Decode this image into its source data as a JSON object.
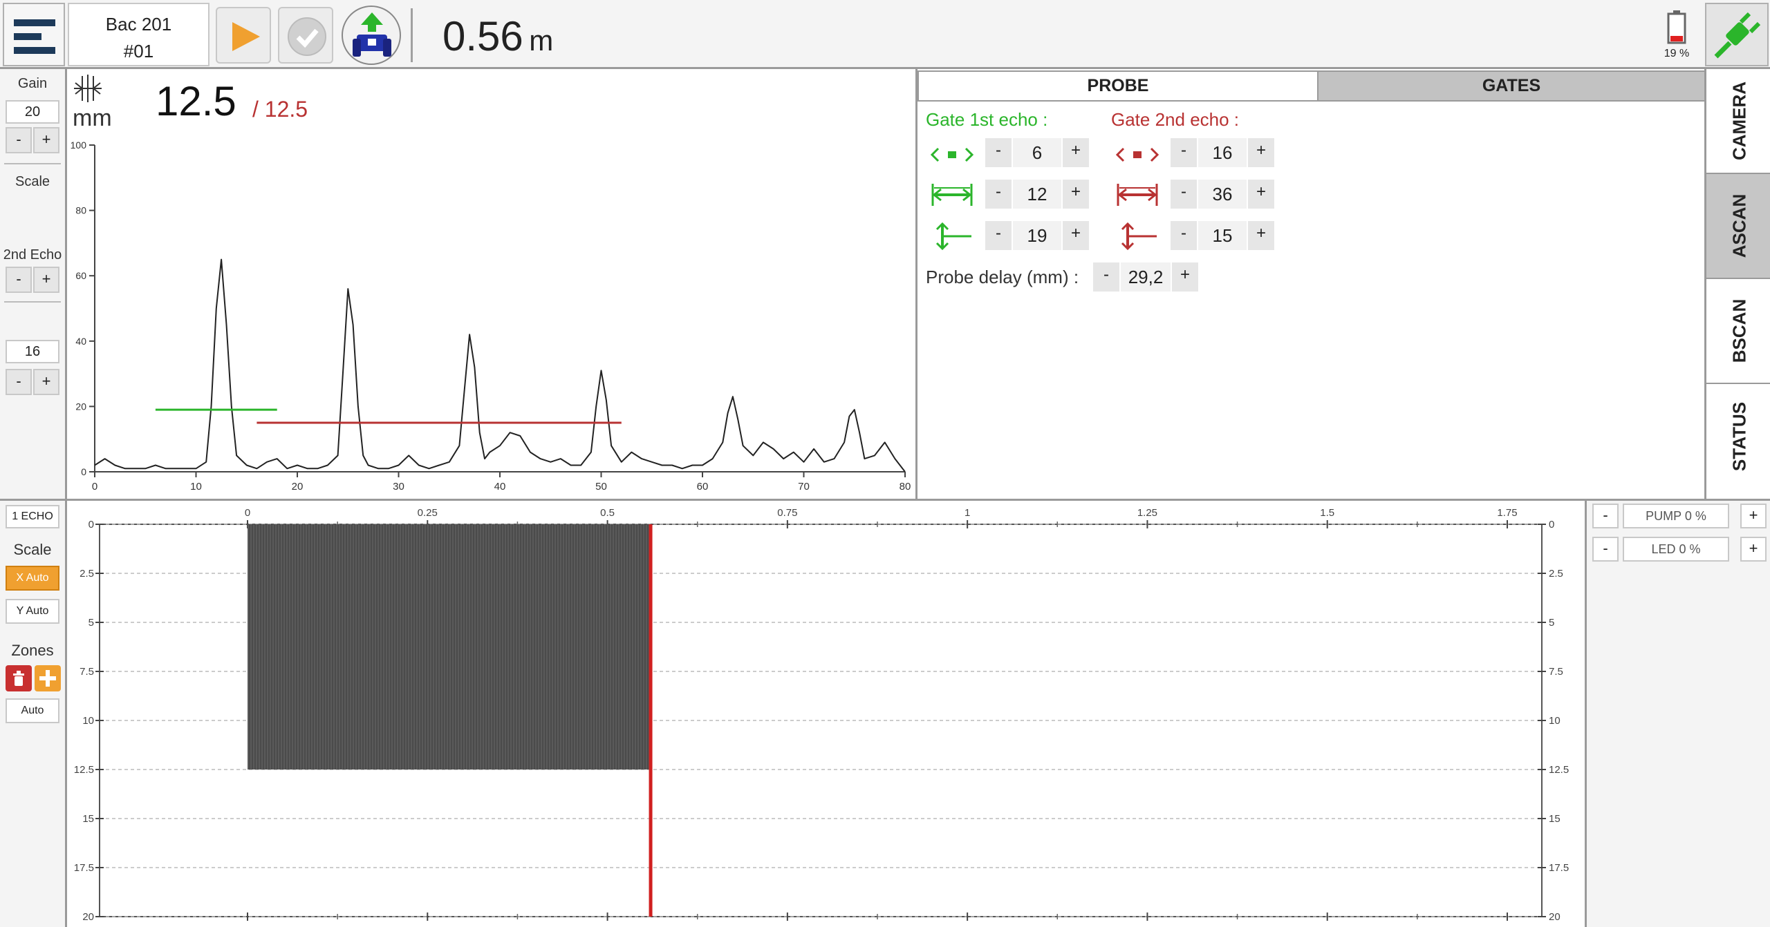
{
  "header": {
    "site": "Bac 201",
    "probe_id": "#01",
    "distance_value": "0.56",
    "distance_unit": "m",
    "battery": "19 %"
  },
  "left_panel": {
    "gain_label": "Gain",
    "gain_value": "20",
    "scale_label": "Scale",
    "second_echo_label": "2nd Echo",
    "second_echo_value": "16",
    "minus": "-",
    "plus": "+"
  },
  "ascan": {
    "unit": "mm",
    "thickness": "12.5",
    "thickness_second": "/ 12.5"
  },
  "tabs": {
    "probe": "PROBE",
    "gates": "GATES"
  },
  "gates": {
    "first_label": "Gate 1st echo :",
    "second_label": "Gate 2nd echo :",
    "first": {
      "position": "6",
      "width": "12",
      "level": "19"
    },
    "second": {
      "position": "16",
      "width": "36",
      "level": "15"
    },
    "probe_delay_label": "Probe delay (mm) :",
    "probe_delay_value": "29,2"
  },
  "side_tabs": [
    "CAMERA",
    "ASCAN",
    "BSCAN",
    "STATUS"
  ],
  "bscan_controls": {
    "echo_mode": "1 ECHO",
    "scale_label": "Scale",
    "x_auto": "X Auto",
    "y_auto": "Y Auto",
    "zones_label": "Zones",
    "auto": "Auto"
  },
  "right_controls": {
    "pump": "PUMP 0 %",
    "led": "LED 0 %"
  },
  "colors": {
    "green": "#2bb52b",
    "red": "#b83232",
    "accent_orange": "#f0a030",
    "bscan_fill": "#5a5a5a",
    "cursor": "#d02020"
  },
  "chart_data": [
    {
      "type": "line",
      "x_ticks": [
        "0",
        "10",
        "20",
        "30",
        "40",
        "50",
        "60",
        "70",
        "80"
      ],
      "y_ticks": [
        "0",
        "20",
        "40",
        "60",
        "80",
        "100"
      ],
      "xlim": [
        0,
        80
      ],
      "ylim": [
        0,
        100
      ],
      "series": [
        {
          "x": [
            0,
            1,
            2,
            3,
            4,
            5,
            6,
            7,
            8,
            9,
            10,
            11,
            11.5,
            12,
            12.5,
            13,
            13.5,
            14,
            15,
            16,
            17,
            18,
            19,
            20,
            21,
            22,
            23,
            24,
            24.5,
            25,
            25.5,
            26,
            26.5,
            27,
            28,
            29,
            30,
            31,
            32,
            33,
            34,
            35,
            36,
            36.5,
            37,
            37.5,
            38,
            38.5,
            39,
            40,
            41,
            42,
            43,
            44,
            45,
            46,
            47,
            48,
            49,
            49.5,
            50,
            50.5,
            51,
            52,
            53,
            54,
            55,
            56,
            57,
            58,
            59,
            60,
            61,
            62,
            62.5,
            63,
            63.5,
            64,
            65,
            66,
            67,
            68,
            69,
            70,
            71,
            72,
            73,
            74,
            74.5,
            75,
            75.5,
            76,
            77,
            78,
            79,
            80
          ],
          "y": [
            2,
            4,
            2,
            1,
            1,
            1,
            2,
            1,
            1,
            1,
            1,
            3,
            20,
            50,
            65,
            45,
            20,
            5,
            2,
            1,
            3,
            4,
            1,
            2,
            1,
            1,
            2,
            5,
            30,
            56,
            45,
            20,
            5,
            2,
            1,
            1,
            2,
            5,
            2,
            1,
            2,
            3,
            8,
            25,
            42,
            32,
            12,
            4,
            6,
            8,
            12,
            11,
            6,
            4,
            3,
            4,
            2,
            2,
            6,
            20,
            31,
            22,
            8,
            3,
            6,
            4,
            3,
            2,
            2,
            1,
            2,
            2,
            4,
            9,
            18,
            23,
            16,
            8,
            5,
            9,
            7,
            4,
            6,
            3,
            7,
            3,
            4,
            9,
            17,
            19,
            12,
            4,
            5,
            9,
            4,
            0
          ]
        }
      ],
      "gates": [
        {
          "name": "Gate 1st echo",
          "x": [
            6,
            18
          ],
          "y": 19
        },
        {
          "name": "Gate 2nd echo",
          "x": [
            16,
            52
          ],
          "y": 15
        }
      ]
    },
    {
      "type": "area",
      "x_ticks": [
        "0",
        "0.25",
        "0.5",
        "0.75",
        "1",
        "1.25",
        "1.5",
        "1.75"
      ],
      "y_ticks": [
        "0",
        "2.5",
        "5",
        "7.5",
        "10",
        "12.5",
        "15",
        "17.5",
        "20"
      ],
      "xlim": [
        0,
        1.75
      ],
      "ylim": [
        20,
        0
      ],
      "fill": {
        "x": [
          0,
          0.56
        ],
        "y": 12.5
      },
      "cursor_x": 0.56
    }
  ]
}
